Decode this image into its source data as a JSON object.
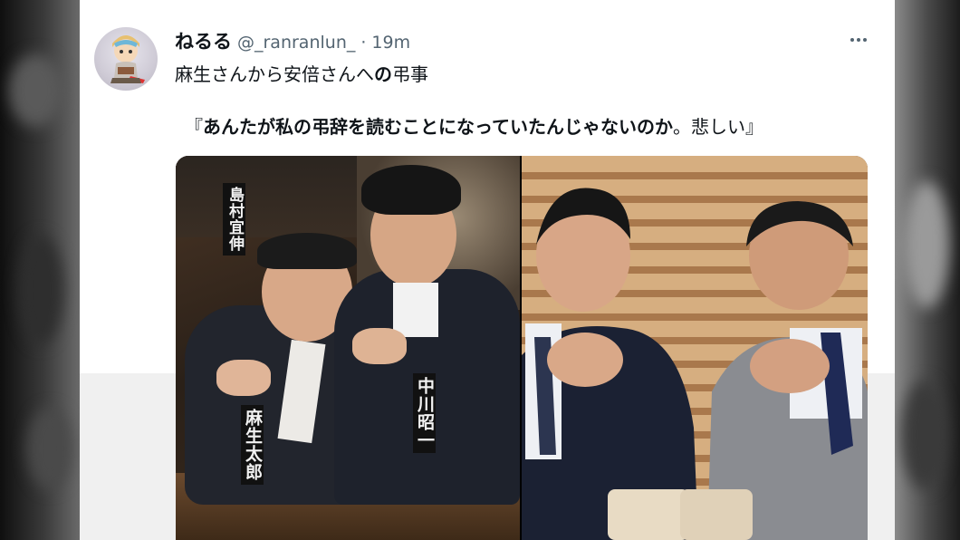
{
  "tweet": {
    "display_name": "ねるる",
    "handle": "@_ranranlun_",
    "separator": "·",
    "time": "19m",
    "line1_main": "麻生さんから安倍さんへ",
    "line1_bold": "の",
    "line1_end": "弔事",
    "quote_open": "『",
    "quote_bold": "あんたが私の弔辞を読むことになっていたんじゃないのか",
    "quote_rest": "。悲しい』"
  },
  "photo_left": {
    "nameplates": [
      {
        "text": "島村宜伸",
        "role": "nameplate-top-left"
      },
      {
        "text": "麻生太郎",
        "role": "nameplate-bottom-left"
      },
      {
        "text": "中川昭一",
        "role": "nameplate-bottom-right"
      }
    ]
  },
  "colors": {
    "text_primary": "#0f1419",
    "text_secondary": "#536471",
    "card_background": "#ffffff",
    "page_background": "#1a1a1a"
  }
}
